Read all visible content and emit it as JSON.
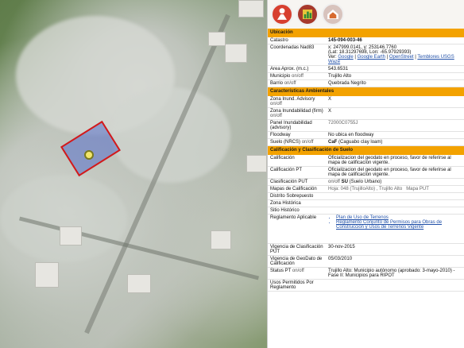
{
  "sections": {
    "ubicacion": "Ubicación",
    "caracteristicas": "Características Ambientales",
    "calificacion": "Calificación y Clasificación de Suelo"
  },
  "ubicacion": {
    "catastro_label": "Catastro",
    "catastro_value": "145-094-003-46",
    "coords_label": "Coordenadas Nad83",
    "coords_xy": "x: 247999.0141, y: 253146.7760",
    "coords_latlon": "(Lat: 18.31297698, Lon: -65.97929393)",
    "coords_ver": "Ver:",
    "links": [
      "Google",
      "Google Earth",
      "OpenStreet",
      "Temblores USGS",
      "Waze"
    ],
    "area_label": "Area Aprox. (m.c.)",
    "area_value": "543.6531",
    "municipio_label": "Municipio",
    "municipio_value": "Trujillo Alto",
    "barrio_label": "Barrio",
    "barrio_value": "Quebrada Negrito"
  },
  "onoff": "on/off",
  "ambientales": {
    "zona_advisory_label": "Zona Inund. Advisory",
    "zona_advisory_value": "X",
    "zona_firm_label": "Zona Inundabilidad (firm)",
    "zona_firm_value": "X",
    "panel_label": "Panel Inundabilidad (advisory)",
    "panel_value": "72000C0755J",
    "floodway_label": "Floodway",
    "floodway_value": "No ubica en floodway",
    "suelo_label": "Suelo (NRCS)",
    "suelo_code": "CaF",
    "suelo_desc": "(Caguabo clay loam)"
  },
  "calificacion": {
    "calif_label": "Calificación",
    "calif_value": "Oficializacion del geodato en proceso, favor de referirse al mapa de calificacion vigente.",
    "califpt_label": "Calificación PT",
    "califpt_value": "Oficializacion del geodato en proceso, favor de referirse al mapa de calificacion vigente.",
    "clasifput_label": "Clasificación PUT",
    "clasifput_code": "SU",
    "clasifput_desc": "(Suelo Urbano)",
    "mapas_label": "Mapas de Calificación",
    "mapas_hoja": "Hoja: 048 (TrujilloAlto)",
    "mapas_muni": "Trujillo Alto",
    "mapas_put": "Mapa PUT",
    "distrito_label": "Distrito Sobrepuesto",
    "zona_hist_label": "Zona Histórica",
    "sitio_hist_label": "Sitio Histórico",
    "reglamento_label": "Reglamento Aplicable",
    "reglamento_links": [
      "Plan de Uso de Terrenos",
      "Reglamento Conjunto de Permisos para Obras de Construcción y Usos de Terrenos Vigente"
    ],
    "vig_clasif_label": "Vigencia de Clasificación PUT",
    "vig_clasif_value": "30-nov-2015",
    "vig_geodato_label": "Vigencia de GeoDato de Calificación",
    "vig_geodato_value": "05/03/2010",
    "status_label": "Status PT",
    "status_value": "Trujillo Alto: Municipio autónomo (aprobado: 3-mayo-2010) - Fase II: Municipios para RIPOT",
    "usos_label": "Usos Permitidos Por Reglamento"
  },
  "icons": [
    "person-icon",
    "chart-icon",
    "house-icon"
  ],
  "colors": {
    "section": "#f3a200",
    "link": "#2150a8",
    "parcel_border": "#d41919",
    "parcel_fill": "#566ec8"
  }
}
